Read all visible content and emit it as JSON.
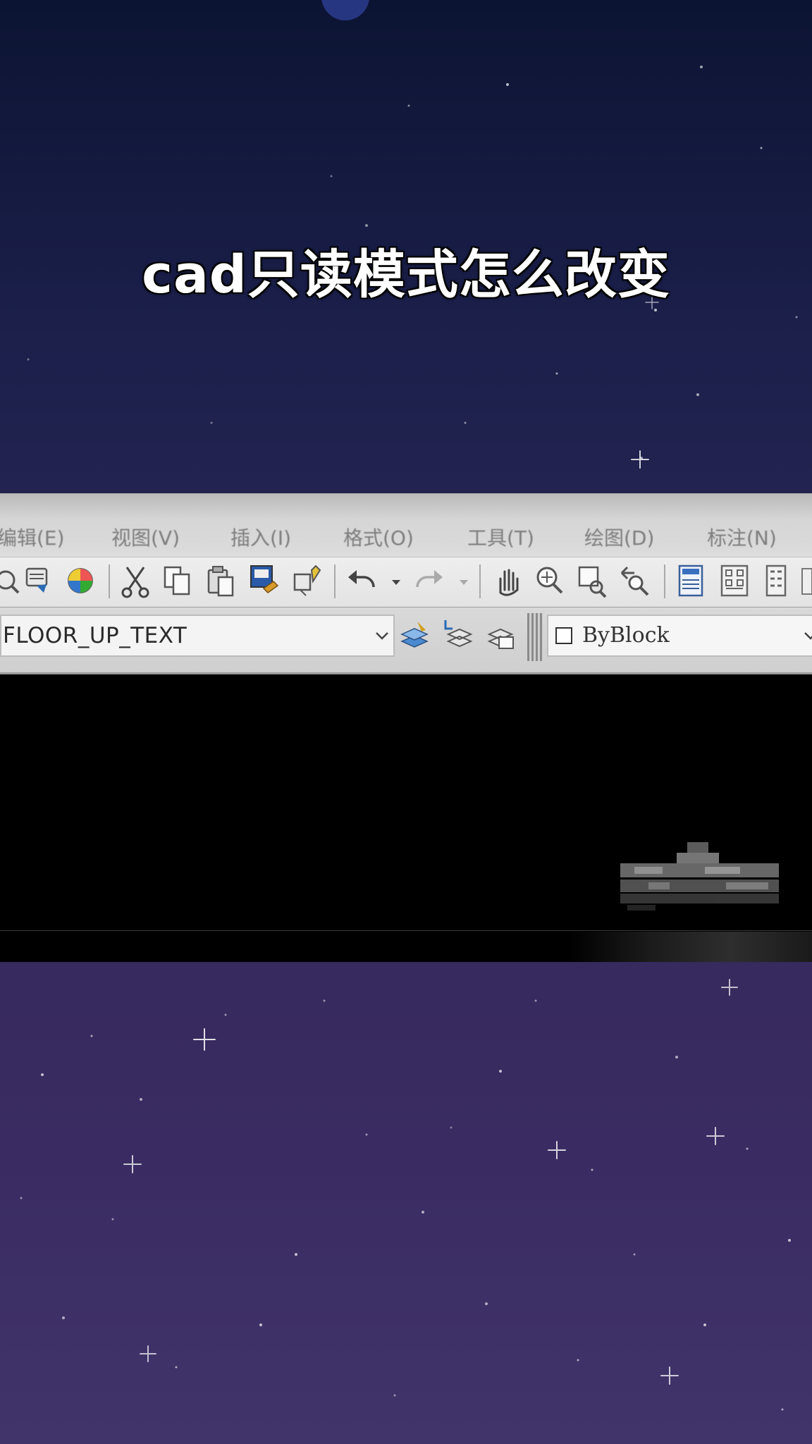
{
  "title": "cad只读模式怎么改变",
  "menu": {
    "items": [
      "编辑(E)",
      "视图(V)",
      "插入(I)",
      "格式(O)",
      "工具(T)",
      "绘图(D)",
      "标注(N)"
    ]
  },
  "toolbar": {
    "icons": [
      "print-preview-icon",
      "publish-icon",
      "render-icon",
      "cut-icon",
      "copy-icon",
      "paste-icon",
      "match-properties-icon",
      "block-editor-icon",
      "undo-icon",
      "redo-icon",
      "pan-icon",
      "zoom-realtime-icon",
      "zoom-window-icon",
      "zoom-previous-icon",
      "properties-icon",
      "design-center-icon",
      "tool-palettes-icon"
    ]
  },
  "layers": {
    "current_layer": "FLOOR_UP_TEXT"
  },
  "properties": {
    "color_value": "ByBlock"
  },
  "colors": {
    "sky_top": "#0c1433",
    "sky_bottom": "#40346a",
    "canvas": "#000000",
    "menubar": "#d5d5d5"
  }
}
